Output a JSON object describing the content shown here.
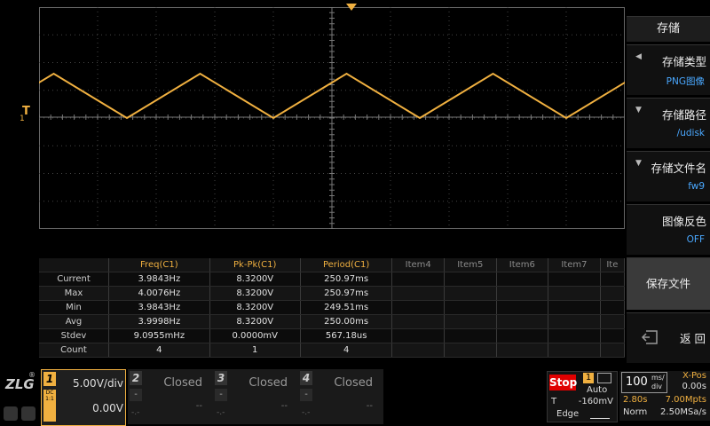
{
  "colors": {
    "trace": "#f0b040",
    "grid": "#444444",
    "accent": "#f0b040",
    "link": "#4aa8ff",
    "stop": "#e00000"
  },
  "trigger_marker": {
    "label": "T",
    "sub": "1"
  },
  "measurements": {
    "headers": [
      "",
      "Freq(C1)",
      "Pk-Pk(C1)",
      "Period(C1)",
      "Item4",
      "Item5",
      "Item6",
      "Item7",
      "Ite"
    ],
    "rows": [
      {
        "label": "Current",
        "v": [
          "3.9843Hz",
          "8.3200V",
          "250.97ms",
          "",
          "",
          "",
          "",
          ""
        ]
      },
      {
        "label": "Max",
        "v": [
          "4.0076Hz",
          "8.3200V",
          "250.97ms",
          "",
          "",
          "",
          "",
          ""
        ]
      },
      {
        "label": "Min",
        "v": [
          "3.9843Hz",
          "8.3200V",
          "249.51ms",
          "",
          "",
          "",
          "",
          ""
        ]
      },
      {
        "label": "Avg",
        "v": [
          "3.9998Hz",
          "8.3200V",
          "250.00ms",
          "",
          "",
          "",
          "",
          ""
        ]
      },
      {
        "label": "Stdev",
        "v": [
          "9.0955mHz",
          "0.0000mV",
          "567.18us",
          "",
          "",
          "",
          "",
          ""
        ]
      },
      {
        "label": "Count",
        "v": [
          "4",
          "1",
          "4",
          "",
          "",
          "",
          "",
          ""
        ]
      }
    ]
  },
  "right_panel": {
    "title": "存储",
    "items": [
      {
        "label": "存储类型",
        "value": "PNG图像",
        "arrow": "◀"
      },
      {
        "label": "存储路径",
        "value": "/udisk",
        "arrow": "▼"
      },
      {
        "label": "存储文件名",
        "value": "fw9",
        "arrow": "▼"
      },
      {
        "label": "图像反色",
        "value": "OFF",
        "arrow": ""
      }
    ],
    "save_label": "保存文件",
    "back_label": "返 回",
    "back_icon": "back-arrow-icon"
  },
  "channels": [
    {
      "num": "1",
      "volts_div": "5.00V/div",
      "offset": "0.00V",
      "coupling": "DC",
      "extra": "1:1"
    },
    {
      "num": "2",
      "status": "Closed",
      "dash": "--",
      "dash_small": "-.-"
    },
    {
      "num": "3",
      "status": "Closed",
      "dash": "--",
      "dash_small": "-.-"
    },
    {
      "num": "4",
      "status": "Closed",
      "dash": "--",
      "dash_small": "-.-"
    }
  ],
  "trigger": {
    "run_state": "Stop",
    "source": "1",
    "mode": "Auto",
    "type_label": "T",
    "level": "-160mV",
    "edge_label": "Edge"
  },
  "timebase": {
    "value": "100",
    "unit_top": "ms/",
    "unit_bottom": "div",
    "xpos_label": "X-Pos",
    "xpos": "0.00s",
    "duration": "2.80s",
    "mem_depth": "7.00Mpts",
    "acq_mode": "Norm",
    "sample_rate": "2.50MSa/s"
  },
  "logo": {
    "text": "ZLG",
    "reg": "®"
  }
}
